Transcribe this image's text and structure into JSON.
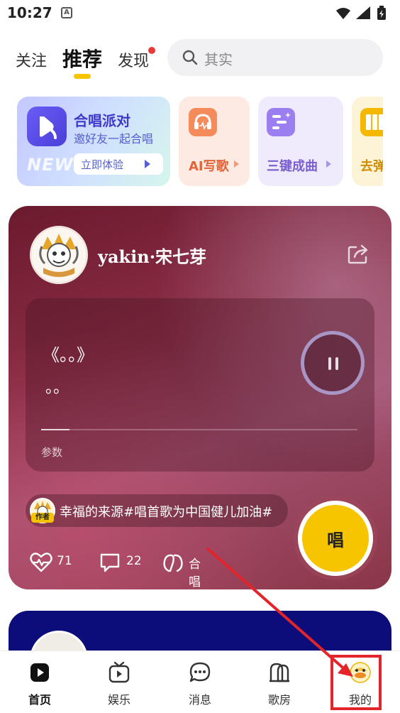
{
  "status_bar": {
    "time": "10:27",
    "notification_glyph": "A"
  },
  "top_tabs": {
    "follow": "关注",
    "recommend": "推荐",
    "discover": "发现"
  },
  "search": {
    "placeholder": "其实"
  },
  "features": {
    "chorus_party": {
      "title": "合唱派对",
      "subtitle": "邀好友一起合唱",
      "badge": "NEW",
      "button": "立即体验"
    },
    "ai_write": {
      "label": "AI写歌"
    },
    "three_key": {
      "label": "三键成曲"
    },
    "play": {
      "label": "去弹"
    }
  },
  "post": {
    "username": "yakin·宋七芽",
    "lyric_line1": "《。。》",
    "lyric_line2": "。。",
    "progress": 0.09,
    "param_label": "参数",
    "topic_badge": "作者",
    "topic": "幸福的来源#唱首歌为中国健儿加油#",
    "sing_label": "唱",
    "likes": "71",
    "comments": "22",
    "chorus_label": "合唱"
  },
  "bottom_nav": {
    "home": "首页",
    "entertainment": "娱乐",
    "messages": "消息",
    "rooms": "歌房",
    "me": "我的"
  },
  "colors": {
    "accent_yellow": "#f7c400",
    "annotation_red": "#e3242b",
    "card_wine": "#8a2c44"
  },
  "icons": [
    "wifi-icon",
    "signal-icon",
    "battery-icon",
    "search-icon",
    "share-icon",
    "pause-icon",
    "heart-icon",
    "comment-icon",
    "chorus-icon",
    "home-icon",
    "tv-icon",
    "chat-icon",
    "group-icon",
    "profile-duck-icon"
  ]
}
